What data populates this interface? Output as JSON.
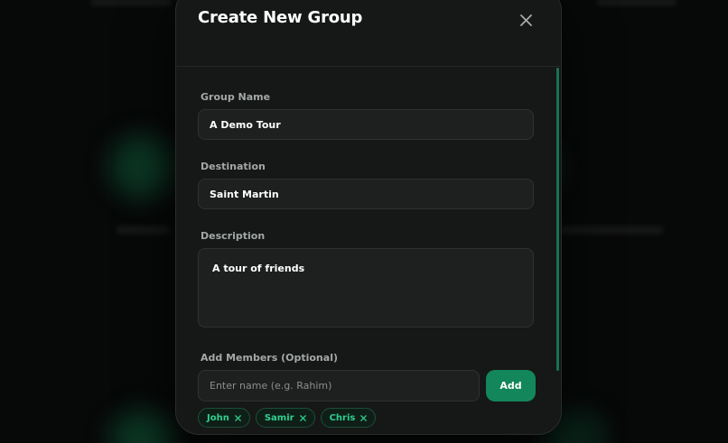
{
  "colors": {
    "accent": "#13865b",
    "accent_text": "#2fd08f",
    "modal_bg": "#161717",
    "input_bg": "#1e1f1f",
    "page_bg": "#070808"
  },
  "modal": {
    "title": "Create New Group",
    "close_icon": "close-icon"
  },
  "form": {
    "group_name": {
      "label": "Group Name",
      "value": "A Demo Tour"
    },
    "destination": {
      "label": "Destination",
      "value": "Saint Martin"
    },
    "description": {
      "label": "Description",
      "value": "A tour of friends"
    },
    "members": {
      "label": "Add Members (Optional)",
      "placeholder": "Enter name (e.g. Rahim)",
      "add_label": "Add",
      "chips": [
        {
          "name": "John",
          "remove_icon": "close-icon"
        },
        {
          "name": "Samir",
          "remove_icon": "close-icon"
        },
        {
          "name": "Chris",
          "remove_icon": "close-icon"
        }
      ]
    }
  }
}
